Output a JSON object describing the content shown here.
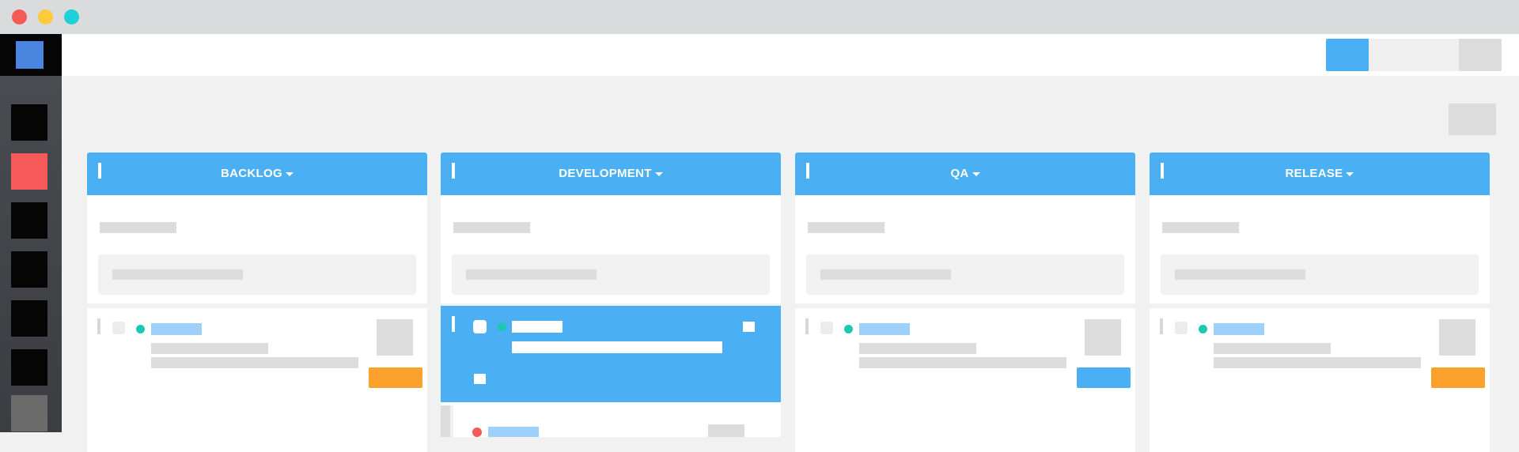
{
  "window": {
    "traffic_lights": [
      "#f65a55",
      "#fbcb3c",
      "#1ed0d8"
    ]
  },
  "sidebar": {
    "logo_color": "#4a86e0",
    "items": [
      {
        "name": "nav-item-1",
        "color": "#050505"
      },
      {
        "name": "nav-item-2",
        "color": "#f65a58",
        "active": true
      },
      {
        "name": "nav-item-3",
        "color": "#050505"
      },
      {
        "name": "nav-item-4",
        "color": "#050505"
      },
      {
        "name": "nav-item-5",
        "color": "#050505"
      },
      {
        "name": "nav-item-6",
        "color": "#050505"
      },
      {
        "name": "nav-item-7",
        "color": "#6b6b6b"
      }
    ]
  },
  "topbar": {
    "segments": [
      {
        "color": "#4baff3",
        "selected": true
      },
      {
        "color": "#f0f0f0"
      },
      {
        "color": "#dcdcdc"
      }
    ]
  },
  "board": {
    "accent": "#4baff3",
    "columns": [
      {
        "title": "BACKLOG",
        "card_button_color": "#fca22c",
        "selected_card": false,
        "dot_color": "#1cc8b1"
      },
      {
        "title": "DEVELOPMENT",
        "card_button_color": null,
        "selected_card": true,
        "dot_color": "#1cc8b1",
        "peek_dot_color": "#f65a58"
      },
      {
        "title": "QA",
        "card_button_color": "#4baff3",
        "selected_card": false,
        "dot_color": "#1cc8b1"
      },
      {
        "title": "RELEASE",
        "card_button_color": "#fca22c",
        "selected_card": false,
        "dot_color": "#1cc8b1"
      }
    ]
  }
}
